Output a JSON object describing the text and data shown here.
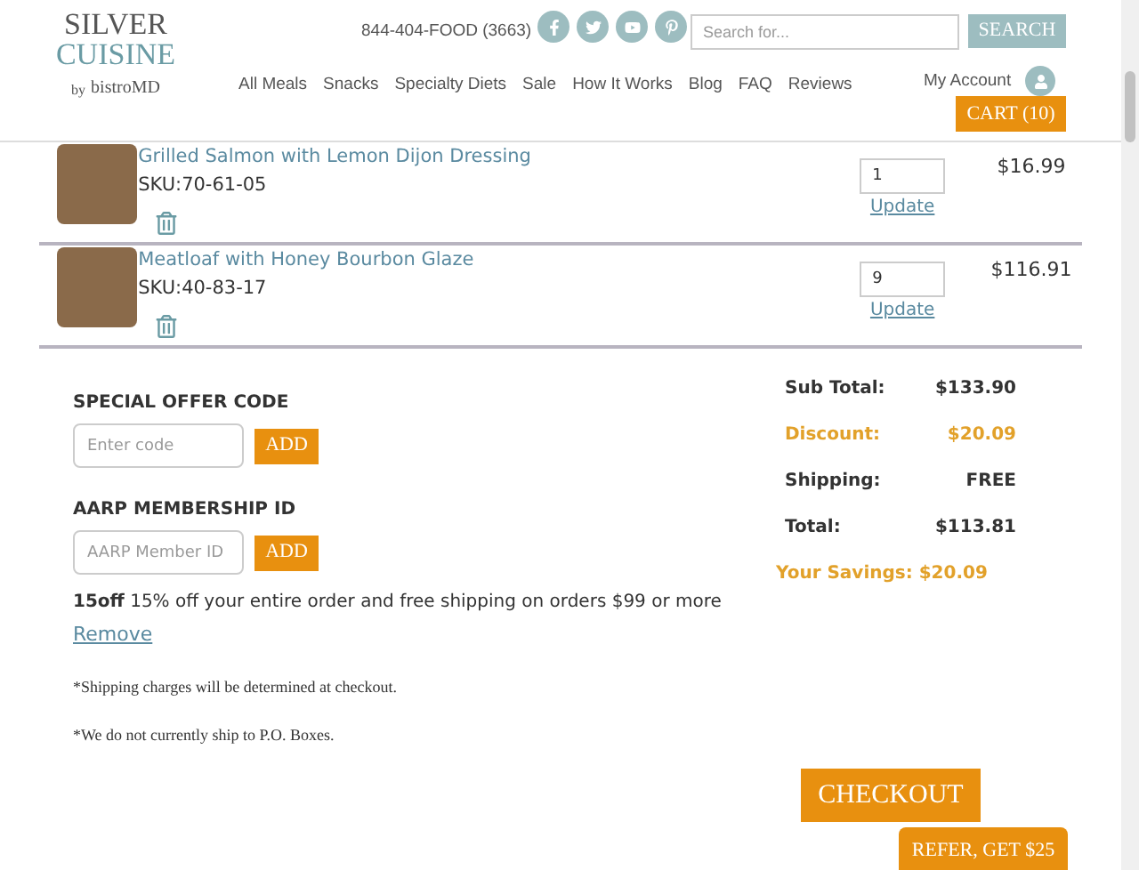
{
  "header": {
    "logo": {
      "line_1": "SILVER",
      "line_2": "CUISINE",
      "by": "by",
      "brand": "bistroMD"
    },
    "phone": "844-404-FOOD (3663)",
    "search": {
      "placeholder": "Search for...",
      "button": "SEARCH"
    },
    "nav": [
      "All Meals",
      "Snacks",
      "Specialty Diets",
      "Sale",
      "How It Works",
      "Blog",
      "FAQ",
      "Reviews"
    ],
    "account": "My Account",
    "cart": "CART (10)"
  },
  "items": [
    {
      "name": "Grilled Salmon with Lemon Dijon Dressing",
      "sku": "SKU:70-61-05",
      "quantity": "1",
      "update": "Update",
      "price": "$16.99"
    },
    {
      "name": "Meatloaf with Honey Bourbon Glaze",
      "sku": "SKU:40-83-17",
      "quantity": "9",
      "update": "Update",
      "price": "$116.91"
    }
  ],
  "offer": {
    "title": "SPECIAL OFFER CODE",
    "placeholder": "Enter code",
    "button": "ADD"
  },
  "aarp": {
    "title": "AARP MEMBERSHIP ID",
    "placeholder": "AARP Member ID",
    "button": "ADD"
  },
  "applied": {
    "code": "15off",
    "description": "15% off your entire order and free shipping on orders $99 or more",
    "remove": "Remove"
  },
  "notes": [
    "*Shipping charges will be determined at checkout.",
    "*We do not currently ship to P.O. Boxes."
  ],
  "summary": [
    {
      "kind": "plain",
      "label": "Sub Total:",
      "value": "$133.90"
    },
    {
      "kind": "discount",
      "label": "Discount:",
      "value": "$20.09"
    },
    {
      "kind": "plain",
      "label": "Shipping:",
      "value": "FREE"
    },
    {
      "kind": "plain",
      "label": "Total:",
      "value": "$113.81"
    }
  ],
  "savings": "Your Savings: $20.09",
  "checkout": "CHECKOUT",
  "refer": "REFER, GET $25"
}
